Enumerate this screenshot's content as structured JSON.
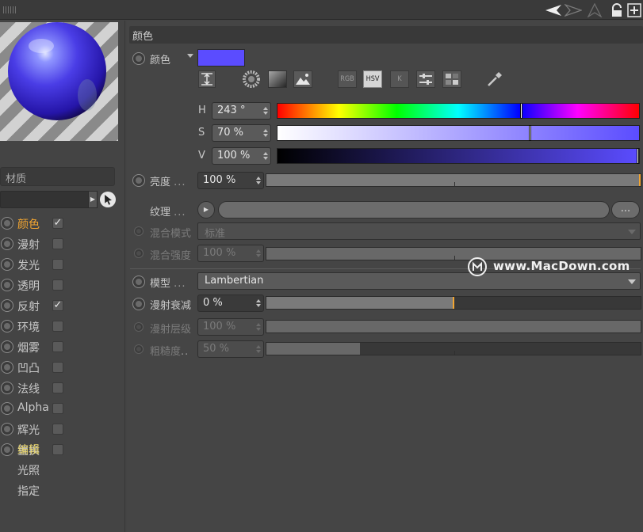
{
  "toolbar": {
    "icons": [
      "grip-icon",
      "back-arrow-icon",
      "forward-arrow-icon",
      "up-arrow-icon",
      "lock-icon",
      "new-window-icon"
    ]
  },
  "left_panel": {
    "material_name": "材质",
    "channels": [
      {
        "label": "颜色",
        "checked": true,
        "active": true
      },
      {
        "label": "漫射",
        "checked": false
      },
      {
        "label": "发光",
        "checked": false
      },
      {
        "label": "透明",
        "checked": false
      },
      {
        "label": "反射",
        "checked": true
      },
      {
        "label": "环境",
        "checked": false
      },
      {
        "label": "烟雾",
        "checked": false
      },
      {
        "label": "凹凸",
        "checked": false
      },
      {
        "label": "法线",
        "checked": false
      },
      {
        "label": "Alpha",
        "checked": false
      },
      {
        "label": "辉光",
        "checked": false
      },
      {
        "label": "置换",
        "checked": false
      }
    ],
    "sub_items": [
      {
        "label": "编辑",
        "active": true
      },
      {
        "label": "光照"
      },
      {
        "label": "指定"
      }
    ],
    "check_mark": "✓"
  },
  "color_section": {
    "title": "颜色",
    "color_label": "颜色",
    "swatch_color": "#5b4cff",
    "mode_buttons": [
      "RGB",
      "HSV",
      "K"
    ],
    "active_mode": "HSV",
    "h": {
      "label": "H",
      "value": "243 °",
      "fraction": 0.675
    },
    "s": {
      "label": "S",
      "value": "70 %",
      "fraction": 0.7
    },
    "v": {
      "label": "V",
      "value": "100 %",
      "fraction": 1.0
    },
    "brightness": {
      "label": "亮度",
      "dots": "...",
      "value": "100 %",
      "fraction": 1.0
    },
    "texture": {
      "label": "纹理",
      "dots": "...",
      "more": "..."
    },
    "blend_mode": {
      "label": "混合模式",
      "value": "标准"
    },
    "blend_strength": {
      "label": "混合强度",
      "value": "100 %",
      "fraction": 1.0
    }
  },
  "model_section": {
    "model": {
      "label": "模型",
      "dots": "...",
      "value": "Lambertian"
    },
    "diffuse_falloff": {
      "label": "漫射衰减",
      "value": "0 %",
      "fraction": 0.5
    },
    "diffuse_level": {
      "label": "漫射层级",
      "value": "100 %",
      "fraction": 1.0
    },
    "roughness": {
      "label": "粗糙度",
      "dots": "..",
      "value": "50 %",
      "fraction": 0.25
    }
  },
  "watermark": {
    "text": "www.MacDown.com"
  }
}
